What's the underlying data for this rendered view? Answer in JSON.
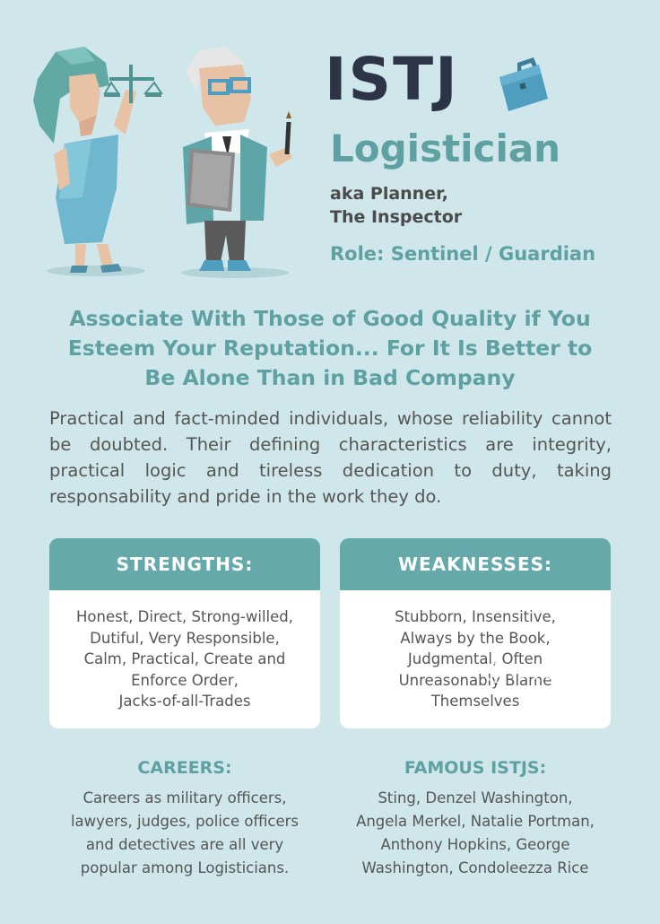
{
  "header": {
    "type_code": "ISTJ",
    "type_name": "Logistician",
    "aka_lines": [
      "aka Planner,",
      "The Inspector"
    ],
    "role": "Role: Sentinel / Guardian"
  },
  "quote_lines": [
    "Associate With Those of Good Quality if You",
    "Esteem Your Reputation... For It Is Better to",
    "Be Alone Than in Bad Company"
  ],
  "description": "Practical and fact-minded individuals, whose reliability cannot be doubted. Their defining characteristics are integrity, practical logic and tireless dedication to duty, taking responsability and pride in the work they do.",
  "strengths": {
    "title": "STRENGTHS:",
    "lines": [
      "Honest, Direct, Strong-willed,",
      "Dutiful, Very Responsible,",
      "Calm, Practical, Create and",
      "Enforce Order,",
      "Jacks-of-all-Trades"
    ]
  },
  "weaknesses": {
    "title": "WEAKNESSES:",
    "lines": [
      "Stubborn, Insensitive,",
      "Always by the Book,",
      "Judgmental, Often",
      "Unreasonably Blame",
      "Themselves"
    ]
  },
  "careers": {
    "title": "CAREERS:",
    "lines": [
      "Careers as military officers,",
      "lawyers, judges, police officers",
      "and detectives are all very",
      "popular among Logisticians."
    ]
  },
  "famous": {
    "title": "FAMOUS ISTJS:",
    "lines": [
      "Sting, Denzel Washington,",
      "Angela Merkel, Natalie Portman,",
      "Anthony Hopkins, George",
      "Washington, Condoleezza Rice"
    ]
  },
  "watermark": "@wvernyx",
  "icons": {
    "illustration": "lady-justice-and-inspector-illustration",
    "briefcase": "briefcase-icon"
  },
  "colors": {
    "background": "#cfe7ea",
    "accent": "#5fa1a3",
    "header_bar": "#65a9ab",
    "title_dark": "#2d3448"
  }
}
